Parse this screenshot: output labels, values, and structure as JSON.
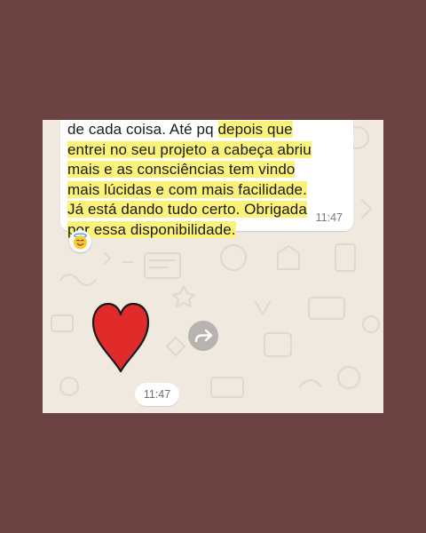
{
  "message": {
    "lines": [
      {
        "plain": "de cada coisa. Até pq ",
        "highlight": "depois que"
      },
      {
        "plain": "",
        "highlight": "entrei no seu projeto a cabeça abriu"
      },
      {
        "plain": "",
        "highlight": "mais e as consciências tem vindo"
      },
      {
        "plain": "",
        "highlight": "mais lúcidas e com mais facilidade."
      },
      {
        "plain": "",
        "highlight": "Já está dando tudo certo. Obrigada"
      },
      {
        "plain": "",
        "highlight": "por essa disponibilidade."
      }
    ],
    "time": "11:47"
  },
  "reaction": {
    "icon": "smiling-face-with-halo-emoji-icon"
  },
  "sticker": {
    "icon": "red-heart-sticker"
  },
  "forward": {
    "icon": "forward-arrow-icon"
  },
  "sticker_time": "11:47",
  "colors": {
    "page_background": "#6b4343",
    "chat_background": "#efe9e0",
    "highlight": "#fbf27a",
    "heart": "#e12a2a",
    "forward_button": "#b7b4b0"
  }
}
